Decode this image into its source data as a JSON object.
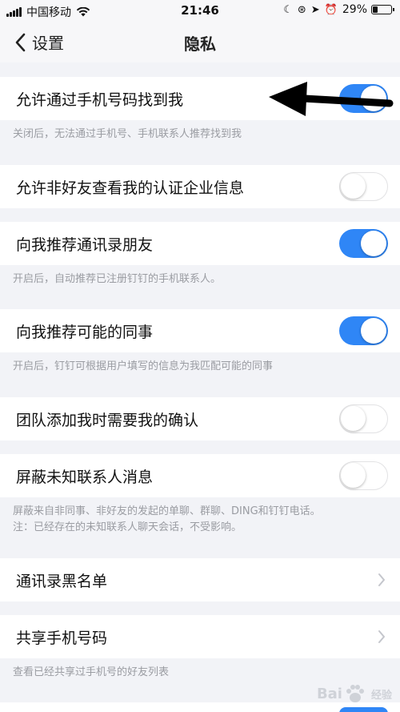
{
  "status_bar": {
    "carrier": "中国移动",
    "time": "21:46",
    "battery": "29%",
    "battery_level": 0.29
  },
  "nav": {
    "back_label": "设置",
    "title": "隐私"
  },
  "settings": [
    {
      "label": "允许通过手机号码找到我",
      "on": true,
      "note": "关闭后，无法通过手机号、手机联系人推荐找到我"
    },
    {
      "label": "允许非好友查看我的认证企业信息",
      "on": false
    },
    {
      "label": "向我推荐通讯录朋友",
      "on": true,
      "note": "开启后，自动推荐已注册钉钉的手机联系人。"
    },
    {
      "label": "向我推荐可能的同事",
      "on": true,
      "note": "开启后，钉钉可根据用户填写的信息为我匹配可能的同事"
    },
    {
      "label": "团队添加我时需要我的确认",
      "on": false
    },
    {
      "label": "屏蔽未知联系人消息",
      "on": false,
      "note_lines": [
        "屏蔽来自非同事、非好友的发起的单聊、群聊、DING和钉钉电话。",
        "注：已经存在的未知联系人聊天会话，不受影响。"
      ]
    },
    {
      "label": "通讯录黑名单"
    },
    {
      "label": "共享手机号码",
      "note": "查看已经共享过手机号的好友列表"
    }
  ],
  "watermark": {
    "text": "Bai",
    "suffix": "经验"
  },
  "colors": {
    "accent": "#2f86f6",
    "background": "#f2f3f7",
    "note_text": "#9a9ca2"
  }
}
